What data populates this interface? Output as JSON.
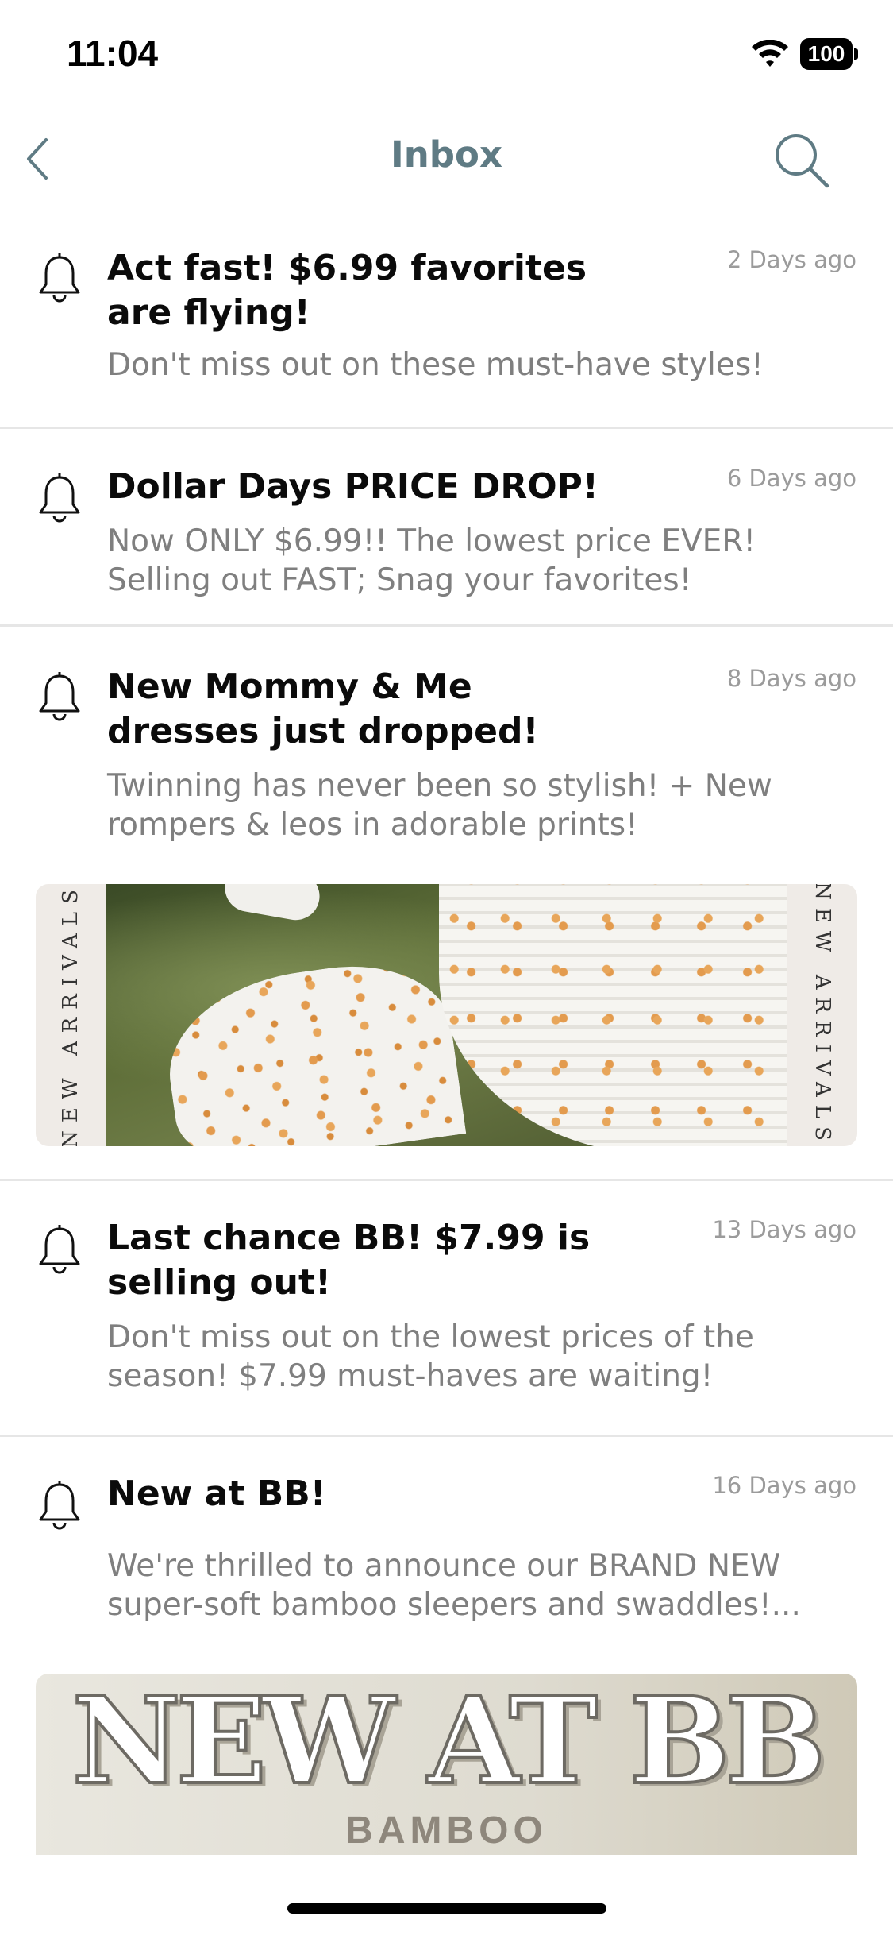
{
  "status": {
    "time": "11:04",
    "battery": "100"
  },
  "nav": {
    "title": "Inbox"
  },
  "messages": [
    {
      "title": "Act fast! $6.99 favorites are flying!",
      "date": "2 Days ago",
      "body": "Don't miss out on these must-have styles!"
    },
    {
      "title": "Dollar Days PRICE DROP!",
      "date": "6 Days ago",
      "body": "Now ONLY $6.99!! The lowest price EVER! Selling out FAST; Snag your favorites!"
    },
    {
      "title": "New Mommy & Me dresses just dropped!",
      "date": "8 Days ago",
      "body": "Twinning has never been so stylish! + New rompers & leos in adorable prints!",
      "banner_side_text": "NEW ARRIVALS"
    },
    {
      "title": "Last chance BB! $7.99 is selling out!",
      "date": "13 Days ago",
      "body": "Don't miss out on the lowest prices of the season! $7.99 must-haves are waiting!"
    },
    {
      "title": "New at BB!",
      "date": "16 Days ago",
      "body": "We're thrilled to announce our BRAND NEW super-soft bamboo sleepers and swaddles!...",
      "banner_title": "NEW AT BB",
      "banner_subtitle": "BAMBOO"
    }
  ],
  "icons": {
    "back": "chevron-left-icon",
    "search": "search-icon",
    "notification": "bell-icon"
  },
  "colors": {
    "nav_accent": "#5f7b84",
    "title": "#0b0b0b",
    "body": "#7f7f7f",
    "date": "#9b9b9b",
    "divider": "#e6e6e6"
  }
}
